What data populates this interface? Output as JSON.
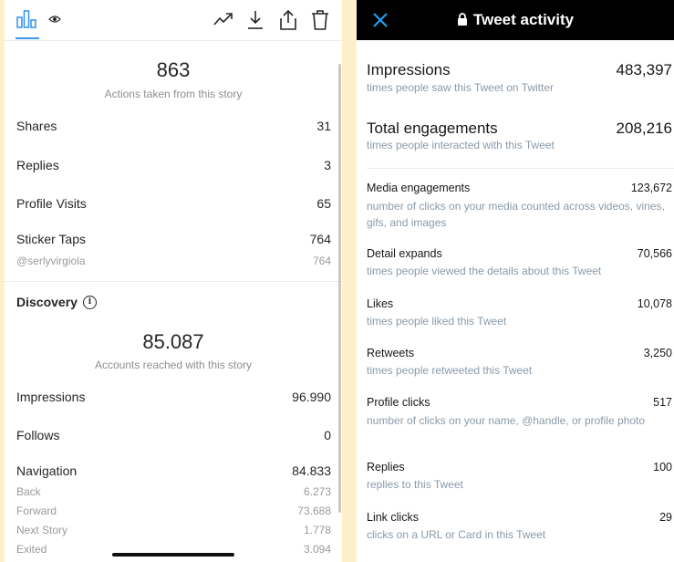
{
  "left": {
    "summary": {
      "value": "863",
      "label": "Actions taken from this story"
    },
    "actions": [
      {
        "label": "Shares",
        "value": "31"
      },
      {
        "label": "Replies",
        "value": "3"
      },
      {
        "label": "Profile Visits",
        "value": "65"
      },
      {
        "label": "Sticker Taps",
        "value": "764"
      }
    ],
    "sticker_sub": {
      "label": "@serlyvirgiola",
      "value": "764"
    },
    "discovery": {
      "title": "Discovery",
      "value": "85.087",
      "label": "Accounts reached with this story",
      "rows": [
        {
          "label": "Impressions",
          "value": "96.990"
        },
        {
          "label": "Follows",
          "value": "0"
        },
        {
          "label": "Navigation",
          "value": "84.833"
        }
      ],
      "navigation_sub": [
        {
          "label": "Back",
          "value": "6.273"
        },
        {
          "label": "Forward",
          "value": "73.688"
        },
        {
          "label": "Next Story",
          "value": "1.778"
        },
        {
          "label": "Exited",
          "value": "3.094"
        }
      ]
    }
  },
  "right": {
    "title": "Tweet activity",
    "close_icon": "close-x-icon",
    "accent": "#1da1f2",
    "metrics": [
      {
        "label": "Impressions",
        "value": "483,397",
        "desc": "times people saw this Tweet on Twitter"
      },
      {
        "label": "Total engagements",
        "value": "208,216",
        "desc": "times people interacted with this Tweet"
      },
      {
        "label": "Media engagements",
        "value": "123,672",
        "desc": "number of clicks on your media counted across videos, vines, gifs, and images"
      },
      {
        "label": "Detail expands",
        "value": "70,566",
        "desc": "times people viewed the details about this Tweet"
      },
      {
        "label": "Likes",
        "value": "10,078",
        "desc": "times people liked this Tweet"
      },
      {
        "label": "Retweets",
        "value": "3,250",
        "desc": "times people retweeted this Tweet"
      },
      {
        "label": "Profile clicks",
        "value": "517",
        "desc": "number of clicks on your name, @handle, or profile photo"
      },
      {
        "label": "Replies",
        "value": "100",
        "desc": "replies to this Tweet"
      },
      {
        "label": "Link clicks",
        "value": "29",
        "desc": "clicks on a URL or Card in this Tweet"
      }
    ]
  }
}
